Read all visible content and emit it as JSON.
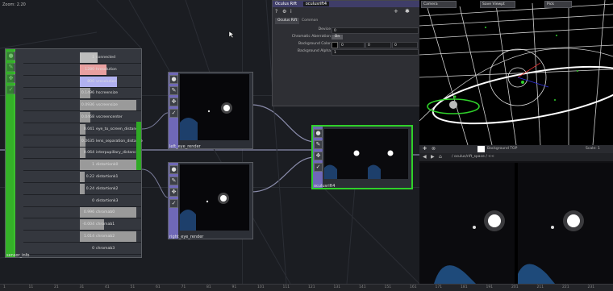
{
  "app": {
    "zoom_label": "Zoom: 2.20",
    "palette_label": "TOP",
    "nav_label": "/"
  },
  "colors": {
    "accent_green": "#3cbf2e",
    "selected_green": "#2fd12a",
    "node_purple": "#6f68b7",
    "param_header": "#3f3d68"
  },
  "sensor_node": {
    "title": "sensor_info",
    "rows": [
      {
        "value": "1",
        "name": "connected",
        "fill": 0.3,
        "color": "#bdbdbd"
      },
      {
        "value": "1280",
        "name": "hresolution",
        "fill": 0.45,
        "color": "#e9a0a0"
      },
      {
        "value": "800",
        "name": "vresolution",
        "fill": 0.62,
        "color": "#b1b1f0"
      },
      {
        "value": "0.1496",
        "name": "hscreensize",
        "fill": 0.18,
        "color": "#9a9a9a"
      },
      {
        "value": "0.0936",
        "name": "vscreensize",
        "fill": 0.95,
        "color": "#9a9a9a"
      },
      {
        "value": "0.0468",
        "name": "vscreencenter",
        "fill": 0.18,
        "color": "#9a9a9a"
      },
      {
        "value": "0.041",
        "name": "eye_to_screen_distance",
        "fill": 0.1,
        "color": "#9a9a9a"
      },
      {
        "value": "0.0635",
        "name": "lens_separation_distance",
        "fill": 0.1,
        "color": "#9a9a9a"
      },
      {
        "value": "0.064",
        "name": "interpupillary_distance",
        "fill": 0.1,
        "color": "#9a9a9a"
      },
      {
        "value": "1",
        "name": "distortionk0",
        "fill": 0.95,
        "color": "#9a9a9a"
      },
      {
        "value": "0.22",
        "name": "distortionk1",
        "fill": 0.08,
        "color": "#9a9a9a"
      },
      {
        "value": "0.24",
        "name": "distortionk2",
        "fill": 0.08,
        "color": "#9a9a9a"
      },
      {
        "value": "0",
        "name": "distortionk3",
        "fill": 0.0,
        "color": "#9a9a9a"
      },
      {
        "value": "0.996",
        "name": "chromab0",
        "fill": 0.95,
        "color": "#9a9a9a"
      },
      {
        "value": "-0.004",
        "name": "chromab1",
        "fill": 0.4,
        "color": "#9a9a9a"
      },
      {
        "value": "1.014",
        "name": "chromab2",
        "fill": 0.95,
        "color": "#9a9a9a"
      },
      {
        "value": "0",
        "name": "chromab3",
        "fill": 0.0,
        "color": "#9a9a9a"
      }
    ]
  },
  "left_node": {
    "title": "left_eye_render"
  },
  "right_node": {
    "title": "right_eye_render"
  },
  "rift_node": {
    "title": "oculusrift4"
  },
  "param_window": {
    "title": "Oculus Rift",
    "name_value": "oculusrift4",
    "tabs": [
      "Oculus Rift",
      "Common"
    ],
    "params": [
      {
        "label": "Device",
        "value": "0"
      },
      {
        "label": "Chromatic Aberration",
        "value": "On"
      },
      {
        "label": "Background Color",
        "value": "0",
        "value2": "0",
        "value3": "0"
      },
      {
        "label": "Background Alpha",
        "value": "1"
      }
    ]
  },
  "viewer3d": {
    "camera": "Camera",
    "mode": "Save Viewpt",
    "view": "Pick"
  },
  "viewer2d": {
    "title": "Background TOP",
    "scale": "Scale: 1",
    "path": "/ oculus/rift_space / <<"
  },
  "timeline": {
    "ticks": [
      "1",
      "11",
      "21",
      "31",
      "41",
      "51",
      "61",
      "71",
      "81",
      "91",
      "101",
      "111",
      "121",
      "131",
      "141",
      "151",
      "161",
      "171",
      "181",
      "191",
      "201",
      "211",
      "221",
      "231"
    ]
  }
}
